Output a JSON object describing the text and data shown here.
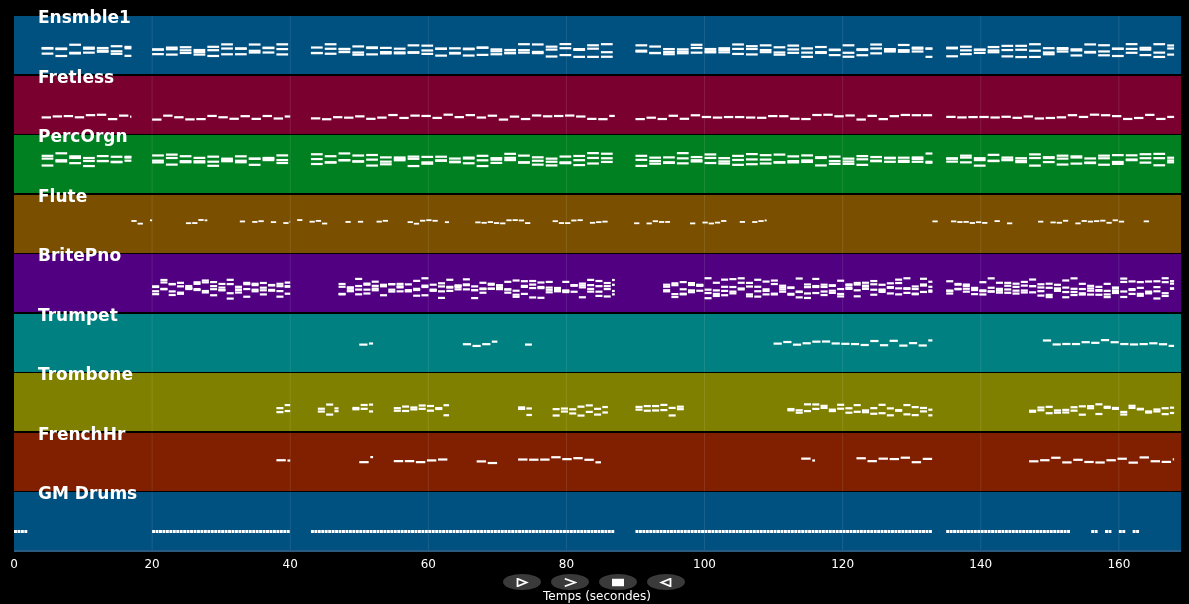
{
  "tracks": [
    {
      "name": "Ensmble1",
      "color": "#005080"
    },
    {
      "name": "Fretless",
      "color": "#7a0030"
    },
    {
      "name": "PercOrgn",
      "color": "#008020"
    },
    {
      "name": "Flute",
      "color": "#7a5000"
    },
    {
      "name": "BritePno",
      "color": "#500080"
    },
    {
      "name": "Trumpet",
      "color": "#008080"
    },
    {
      "name": "Trombone",
      "color": "#808000"
    },
    {
      "name": "FrenchHr",
      "color": "#802000"
    },
    {
      "name": "GM Drums",
      "color": "#005080"
    }
  ],
  "axis": {
    "ticks": [
      "0",
      "20",
      "40",
      "60",
      "80",
      "100",
      "120",
      "140",
      "160"
    ],
    "label": "Temps (secondes)"
  }
}
